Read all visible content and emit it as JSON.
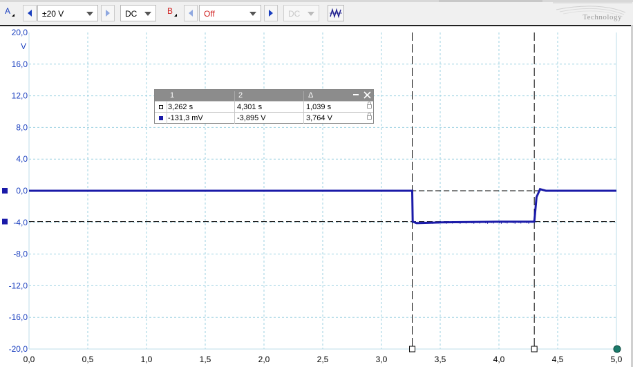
{
  "toolbar": {
    "channel_a": {
      "label": "A",
      "range": "±20 V",
      "coupling": "DC",
      "color": "#1a3fbf"
    },
    "channel_b": {
      "label": "B",
      "range": "Off",
      "coupling": "DC",
      "color": "#d02020"
    },
    "auto_icon": "auto-setup-icon",
    "brand_text": "Technology"
  },
  "measurements": {
    "columns": [
      "1",
      "2",
      "Δ"
    ],
    "rows": [
      {
        "marker": "time-ruler",
        "v1": "3,262 s",
        "v2": "4,301 s",
        "delta": "1,039 s"
      },
      {
        "marker": "channel-a",
        "v1": "-131,3 mV",
        "v2": "-3,895 V",
        "delta": "3,764 V"
      }
    ]
  },
  "chart_data": {
    "type": "line",
    "unit_label": "V",
    "xlim": [
      0,
      5
    ],
    "ylim": [
      -20,
      20
    ],
    "x_ticks": [
      "0,0",
      "0,5",
      "1,0",
      "1,5",
      "2,0",
      "2,5",
      "3,0",
      "3,5",
      "4,0",
      "4,5",
      "5,0"
    ],
    "y_ticks": [
      "20,0",
      "16,0",
      "12,0",
      "8,0",
      "4,0",
      "0,0",
      "-4,0",
      "-8,0",
      "-12,0",
      "-16,0",
      "-20,0"
    ],
    "grid": true,
    "series": [
      {
        "color": "#1a1aa8",
        "x": [
          0,
          3.262,
          3.266,
          3.3,
          3.5,
          4.0,
          4.3,
          4.301,
          4.32,
          4.35,
          4.4,
          5.0
        ],
        "y": [
          0,
          0,
          -3.9,
          -4.1,
          -4.0,
          -3.9,
          -3.9,
          -3.895,
          -0.8,
          0.2,
          0,
          0
        ]
      }
    ],
    "time_rulers": [
      3.262,
      4.301
    ],
    "voltage_rulers": [
      0,
      -3.895
    ]
  }
}
